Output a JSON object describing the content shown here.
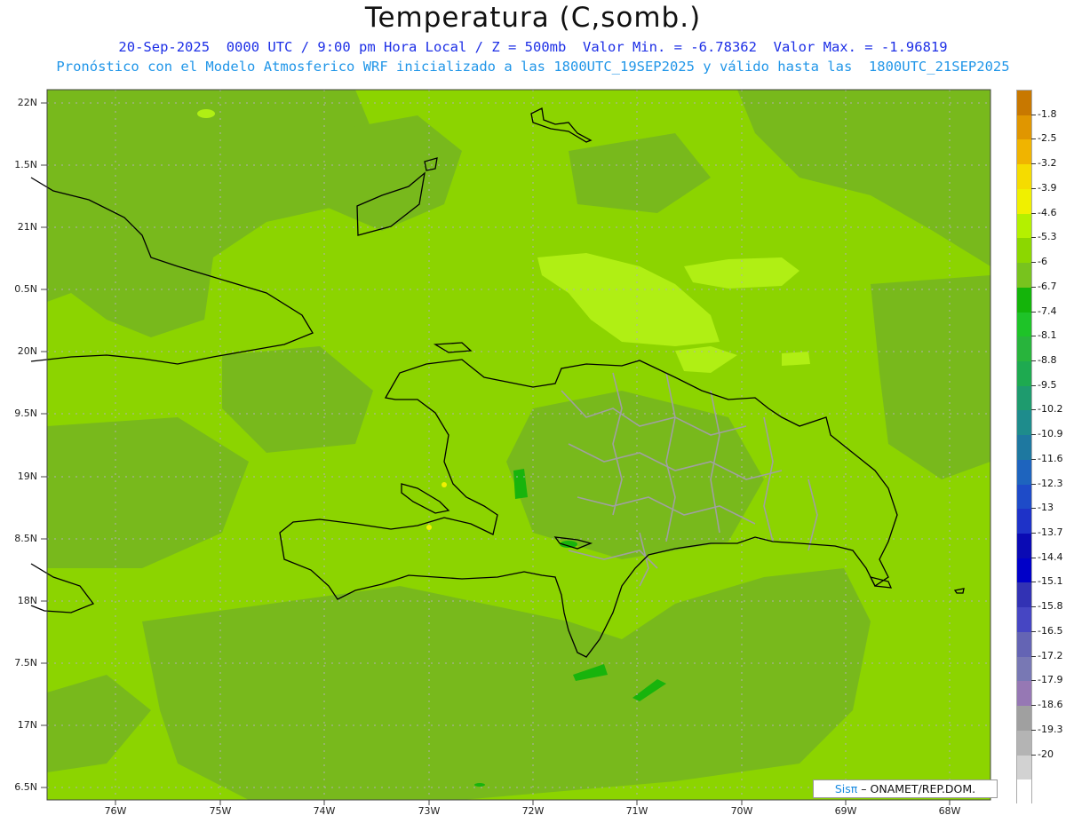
{
  "header": {
    "title": "Temperatura (C,somb.)",
    "line1": "20-Sep-2025  0000 UTC / 9:00 pm Hora Local / Z = 500mb  Valor Min. = -6.78362  Valor Max. = -1.96819",
    "line2": "Pronóstico con el Modelo Atmosferico WRF inicializado a las 1800UTC_19SEP2025 y válido hasta las  1800UTC_21SEP2025"
  },
  "axes": {
    "lat_labels": [
      "22N",
      "1.5N",
      "21N",
      "0.5N",
      "20N",
      "9.5N",
      "19N",
      "8.5N",
      "18N",
      "7.5N",
      "17N",
      "6.5N"
    ],
    "lon_labels": [
      "76W",
      "75W",
      "74W",
      "73W",
      "72W",
      "71W",
      "70W",
      "69W",
      "68W"
    ]
  },
  "credit": {
    "logo": "Sisπ",
    "text": "– ONAMET/REP.DOM."
  },
  "colorbar": {
    "labels": [
      "-1.8",
      "-2.5",
      "-3.2",
      "-3.9",
      "-4.6",
      "-5.3",
      "-6",
      "-6.7",
      "-7.4",
      "-8.1",
      "-8.8",
      "-9.5",
      "-10.2",
      "-10.9",
      "-11.6",
      "-12.3",
      "-13",
      "-13.7",
      "-14.4",
      "-15.1",
      "-15.8",
      "-16.5",
      "-17.2",
      "-17.9",
      "-18.6",
      "-19.3",
      "-20"
    ],
    "colors": [
      "#c87800",
      "#e09600",
      "#f0b400",
      "#f5dc00",
      "#f0f000",
      "#b4f000",
      "#8cd700",
      "#78c31e",
      "#14b40a",
      "#1ec328",
      "#28b43c",
      "#1eaa50",
      "#1e9b6e",
      "#1e8c8c",
      "#1e78a0",
      "#1e64be",
      "#1e4bc8",
      "#1e32c8",
      "#0a0ab4",
      "#0000c8",
      "#3232b4",
      "#4646c3",
      "#6464b4",
      "#7878b4",
      "#9678b4",
      "#a0a0a0",
      "#b4b4b4",
      "#d2d2d2",
      "#ffffff"
    ]
  },
  "map_colors": {
    "base": "#8cd400",
    "dark": "#78b91c",
    "light": "#b0ef14",
    "green": "#18b40c",
    "yellow": "#f0f000",
    "coast": "#000000",
    "province": "#a0a0a0",
    "grid": "#b0b0b0"
  }
}
